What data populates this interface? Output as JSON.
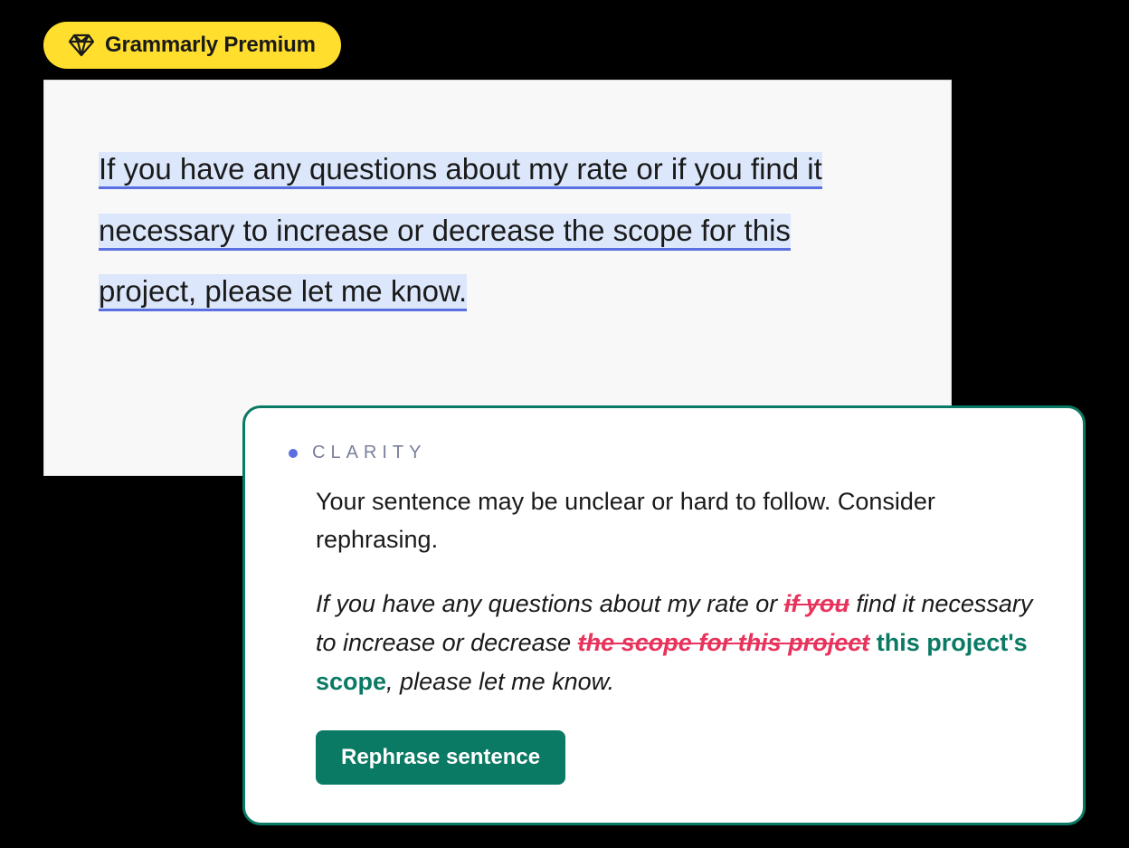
{
  "badge": {
    "label": "Grammarly Premium"
  },
  "editor": {
    "sentence": "If you have any questions about my rate or if you find it necessary to increase or decrease the scope for this project, please let me know."
  },
  "suggestion": {
    "category": "CLARITY",
    "explanation": "Your sentence may be unclear or hard to follow. Consider rephrasing.",
    "rewrite": {
      "seg1": "If you have any questions about my rate or ",
      "strike1": "if you",
      "seg2": " find it necessary to increase or decrease ",
      "strike2": "the scope for this project",
      "insert": " this project's scope",
      "seg3": ", please let me know."
    },
    "button": "Rephrase sentence"
  },
  "colors": {
    "badgeBg": "#FFDE2E",
    "highlight": "#DCE7FB",
    "underline": "#5A6FE0",
    "cardBorder": "#0B7A64",
    "strike": "#E8335D",
    "insert": "#0B7A64"
  }
}
